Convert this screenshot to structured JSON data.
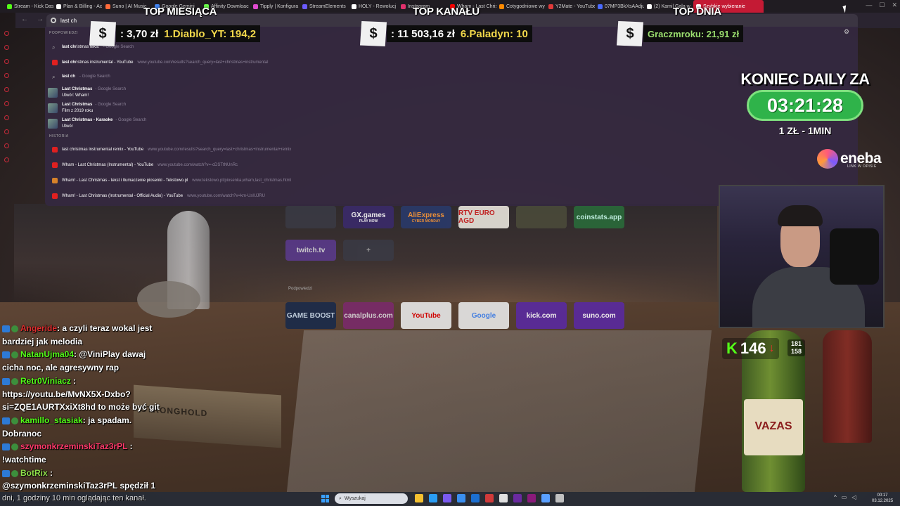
{
  "browser": {
    "tabs": [
      {
        "label": "Stream - Kick Das",
        "color": "#53fc18"
      },
      {
        "label": "Plan & Billing - Ac",
        "color": "#ffffff"
      },
      {
        "label": "Suno | AI Music",
        "color": "#ff6a3a"
      },
      {
        "label": "Google Gemini",
        "color": "#4285f4"
      },
      {
        "label": "Affinity Downloac",
        "color": "#6aff4a"
      },
      {
        "label": "Tipply | Konfigura",
        "color": "#e04ad0"
      },
      {
        "label": "StreamElements",
        "color": "#6b5aff"
      },
      {
        "label": "HOLY - Rewolucj",
        "color": "#ffffff"
      },
      {
        "label": "Instagram",
        "color": "#e1306c"
      },
      {
        "label": "Wham - Last Chris",
        "color": "#ff0000"
      },
      {
        "label": "Cotygodniowe wy",
        "color": "#ff8a00"
      },
      {
        "label": "Y2Mate - YouTube",
        "color": "#e03a3a"
      },
      {
        "label": "07MP3BkXsAAdju",
        "color": "#4a6aff"
      },
      {
        "label": "(2) Kamil Gala w",
        "color": "#ffffff"
      }
    ],
    "active_tab": "Szybkie wybieranie",
    "omnibox_value": "last ch",
    "window_controls": [
      "—",
      "☐",
      "✕"
    ]
  },
  "dropdown": {
    "section_suggestions": "PODPOWIEDZI",
    "suggestions": [
      {
        "bold": "last ch",
        "rest": "ristmas tekst",
        "muted": "- Google Search",
        "icon": "search-icon"
      },
      {
        "bold": "last ch",
        "rest": "ristmas instrumental - YouTube",
        "muted": "www.youtube.com/results?search_query=last+christmas+instrumental",
        "icon": "youtube-icon"
      },
      {
        "bold": "last ch",
        "rest": "",
        "muted": "- Google Search",
        "icon": "search-icon"
      }
    ],
    "rich": [
      {
        "title": "Last Christmas",
        "muted": "- Google Search",
        "sub": "Utwór: Wham!"
      },
      {
        "title": "Last Christmas",
        "muted": "- Google Search",
        "sub": "Film z 2019 roku"
      },
      {
        "title": "Last Christmas - Karaoke",
        "muted": "- Google Search",
        "sub": "Utwór"
      }
    ],
    "section_history": "HISTORIA",
    "history": [
      {
        "text": "last christmas instrumental remix - YouTube",
        "url": "www.youtube.com/results?search_query=last+christmas+instrumental+remix",
        "icon": "youtube-icon"
      },
      {
        "text": "Wham - Last Christmas (Instrumental) - YouTube",
        "url": "www.youtube.com/watch?v=-cDSTtNUnRc",
        "icon": "youtube-icon"
      },
      {
        "text": "Wham! - Last Christmas - tekst i tłumaczenie piosenki - Tekstowo.pl",
        "url": "www.tekstowo.pl/piosenka,wham,last_christmas.html",
        "icon": "tekstowo-icon"
      },
      {
        "text": "Wham! - Last Christmas (Instrumental - Official Audio) - YouTube",
        "url": "www.youtube.com/watch?v=km-UsIUJRU",
        "icon": "youtube-icon"
      }
    ]
  },
  "overlay": {
    "top_month": {
      "title": "TOP MIESIĄCA",
      "amount": ": 3,70 zł",
      "leader": "1.Diablo_YT: 194,2"
    },
    "top_channel": {
      "title": "TOP KANAŁU",
      "amount": ": 11 503,16 zł",
      "leader": "6.Paladyn: 10"
    },
    "top_day": {
      "title": "TOP DNIA",
      "leader": "Graczmroku: 21,91 zł"
    },
    "currency_symbol": "$",
    "daily_title": "KONIEC DAILY ZA",
    "daily_timer": "03:21:28",
    "daily_rate": "1 ZŁ - 1MIN",
    "sponsor": {
      "name": "eneba",
      "sub": "LINK W OPISIE"
    },
    "kick_logo": "K",
    "viewers": "146",
    "viewers_arrow": "↓",
    "followers_a": "181",
    "followers_b": "158"
  },
  "tiles": {
    "label": "Podpowiedzi",
    "row1": [
      "",
      "GX.games",
      "AliExpress",
      "RTV EURO AGD",
      "",
      "coinstats.app"
    ],
    "row1_sub": [
      "",
      "PLAY NOW",
      "CYBER MONDAY",
      "",
      "",
      ""
    ],
    "row2": [
      "twitch.tv",
      "+"
    ],
    "row3": [
      "GAME BOOST",
      "canalplus.com",
      "YouTube",
      "Google",
      "kick.com",
      "suno.com"
    ]
  },
  "scene": {
    "bottle_label": "VAZAS",
    "ammo_label": "STRONGHOLD"
  },
  "chat": [
    {
      "nick": "Angeride",
      "text": ": a czyli teraz wokal jest",
      "nick_color": "#e02f2f"
    },
    {
      "nick": "",
      "text": "bardziej jak melodia",
      "nick_color": ""
    },
    {
      "nick": "NatanUjma04",
      "text": ": @ViniPlay dawaj",
      "nick_color": "#53fc18"
    },
    {
      "nick": "",
      "text": "cicha noc, ale agresywny rap",
      "nick_color": ""
    },
    {
      "nick": "Retr0Viniacz",
      "text": " :",
      "nick_color": "#53fc18"
    },
    {
      "nick": "",
      "text": "https://youtu.be/MvNX5X-Dxbo?",
      "nick_color": ""
    },
    {
      "nick": "",
      "text": "si=ZQE1AURTXxiXt8hd to może być git",
      "nick_color": ""
    },
    {
      "nick": "kamillo_stasiak",
      "text": ": ja spadam.",
      "nick_color": "#53fc18"
    },
    {
      "nick": "",
      "text": "Dobranoc",
      "nick_color": ""
    },
    {
      "nick": "szymonkrzeminskiTaz3rPL",
      "text": " :",
      "nick_color": "#ff3a6a"
    },
    {
      "nick": "",
      "text": "!watchtime",
      "nick_color": ""
    },
    {
      "nick": "BotRix",
      "text": " :",
      "nick_color": "#8fe04a"
    },
    {
      "nick": "",
      "text": "@szymonkrzeminskiTaz3rPL spędził 1",
      "nick_color": ""
    }
  ],
  "taskbar": {
    "ticker": "dni, 1 godziny 10 min oglądając ten kanał.",
    "search_placeholder": "Wyszukaj",
    "time": "00:17",
    "date": "03.12.2025",
    "icon_colors": [
      "#f4c030",
      "#2a9df4",
      "#7a5af0",
      "#3a8ff0",
      "#1c6fd0",
      "#d03a3a",
      "#e0e0e0",
      "#6a2aa0",
      "#8a1a7a",
      "#5aa0ff",
      "#c0c0c0"
    ]
  }
}
